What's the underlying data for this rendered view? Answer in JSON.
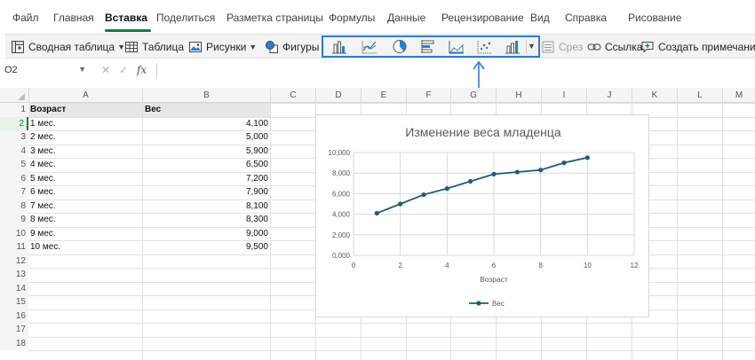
{
  "menu": {
    "items": [
      "Файл",
      "Главная",
      "Вставка",
      "Поделиться",
      "Разметка страницы",
      "Формулы",
      "Данные",
      "Рецензирование",
      "Вид",
      "Справка",
      "Рисование"
    ],
    "active_index": 2
  },
  "ribbon": {
    "pivot_label": "Сводная таблица",
    "table_label": "Таблица",
    "pictures_label": "Рисунки",
    "shapes_label": "Фигуры",
    "slicer_label": "Срез",
    "link_label": "Ссылка",
    "comment_label": "Создать примечание",
    "chart_buttons": [
      "column-chart-icon",
      "line-chart-icon",
      "pie-chart-icon",
      "bar-chart-icon",
      "area-chart-icon",
      "scatter-chart-icon",
      "combo-chart-icon"
    ]
  },
  "formula_bar": {
    "name_box": "O2",
    "fx": "fx",
    "value": ""
  },
  "columns": [
    "A",
    "B",
    "C",
    "D",
    "E",
    "F",
    "G",
    "H",
    "I",
    "J",
    "K",
    "L",
    "M"
  ],
  "rows": [
    "1",
    "2",
    "3",
    "4",
    "5",
    "6",
    "7",
    "8",
    "9",
    "10",
    "11",
    "12",
    "13",
    "14",
    "15",
    "16",
    "17",
    "18"
  ],
  "selected_row": "2",
  "table": {
    "headers": [
      "Возраст",
      "Вес"
    ],
    "rows": [
      [
        "1 мес.",
        "4,100"
      ],
      [
        "2 мес.",
        "5,000"
      ],
      [
        "3 мес.",
        "5,900"
      ],
      [
        "4 мес.",
        "6,500"
      ],
      [
        "5 мес.",
        "7,200"
      ],
      [
        "6 мес.",
        "7,900"
      ],
      [
        "7 мес.",
        "8,100"
      ],
      [
        "8 мес.",
        "8,300"
      ],
      [
        "9 мес.",
        "9,000"
      ],
      [
        "10 мес.",
        "9,500"
      ]
    ]
  },
  "colors": {
    "accent": "#107c41",
    "highlight": "#2b7cd3",
    "series": "#1f5c7a"
  },
  "chart_data": {
    "type": "scatter",
    "title": "Изменение веса младенца",
    "xlabel": "Возраст",
    "ylabel": "",
    "xlim": [
      0,
      12
    ],
    "ylim": [
      0,
      10000
    ],
    "xticks": [
      0,
      2,
      4,
      6,
      8,
      10,
      12
    ],
    "yticks": [
      "0,000",
      "2,000",
      "4,000",
      "6,000",
      "8,000",
      "10,000"
    ],
    "grid": true,
    "legend": "bottom",
    "series": [
      {
        "name": "Вес",
        "x": [
          1,
          2,
          3,
          4,
          5,
          6,
          7,
          8,
          9,
          10
        ],
        "y": [
          4100,
          5000,
          5900,
          6500,
          7200,
          7900,
          8100,
          8300,
          9000,
          9500
        ]
      }
    ]
  }
}
